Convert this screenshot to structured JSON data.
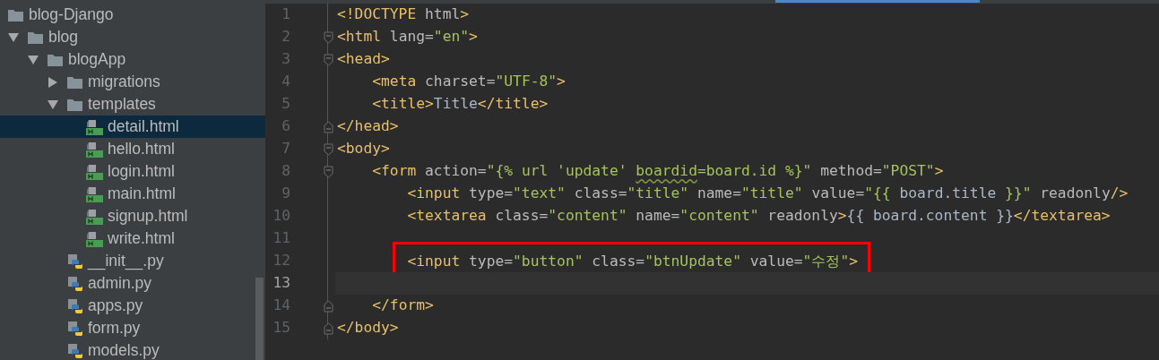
{
  "project_tree": [
    {
      "label": "blog-Django",
      "kind": "folder",
      "selected": false
    },
    {
      "label": "blog",
      "kind": "folder",
      "expanded": true,
      "selected": false,
      "children": [
        {
          "label": "blogApp",
          "kind": "folder",
          "expanded": true,
          "selected": false,
          "children": [
            {
              "label": "migrations",
              "kind": "folder",
              "expanded": false,
              "selected": false
            },
            {
              "label": "templates",
              "kind": "folder",
              "expanded": true,
              "selected": false,
              "children": [
                {
                  "label": "detail.html",
                  "kind": "html",
                  "selected": true
                },
                {
                  "label": "hello.html",
                  "kind": "html",
                  "selected": false
                },
                {
                  "label": "login.html",
                  "kind": "html",
                  "selected": false
                },
                {
                  "label": "main.html",
                  "kind": "html",
                  "selected": false
                },
                {
                  "label": "signup.html",
                  "kind": "html",
                  "selected": false
                },
                {
                  "label": "write.html",
                  "kind": "html",
                  "selected": false
                }
              ]
            },
            {
              "label": "__init__.py",
              "kind": "python",
              "selected": false
            },
            {
              "label": "admin.py",
              "kind": "python",
              "selected": false
            },
            {
              "label": "apps.py",
              "kind": "python",
              "selected": false
            },
            {
              "label": "form.py",
              "kind": "python",
              "selected": false
            },
            {
              "label": "models.py",
              "kind": "python",
              "selected": false
            }
          ]
        }
      ]
    }
  ],
  "editor": {
    "lines": [
      {
        "number": "1",
        "kind": "plain",
        "tokens": [
          {
            "kind": "tag",
            "text": "<!DOCTYPE "
          },
          {
            "kind": "attr",
            "text": "html"
          },
          {
            "kind": "tag",
            "text": ">"
          }
        ]
      },
      {
        "number": "2",
        "kind": "foldstart",
        "tokens": [
          {
            "kind": "tag",
            "text": "<html "
          },
          {
            "kind": "attr",
            "text": "lang="
          },
          {
            "kind": "str",
            "text": "\"en\""
          },
          {
            "kind": "tag",
            "text": ">"
          }
        ]
      },
      {
        "number": "3",
        "kind": "foldstart",
        "tokens": [
          {
            "kind": "tag",
            "text": "<head>"
          }
        ]
      },
      {
        "number": "4",
        "kind": "plain",
        "tokens": [
          {
            "kind": "tag",
            "text": "    <meta "
          },
          {
            "kind": "attr",
            "text": "charset="
          },
          {
            "kind": "str",
            "text": "\"UTF-8\""
          },
          {
            "kind": "tag",
            "text": ">"
          }
        ]
      },
      {
        "number": "5",
        "kind": "plain",
        "tokens": [
          {
            "kind": "tag",
            "text": "    <title>"
          },
          {
            "kind": "text",
            "text": "Title"
          },
          {
            "kind": "tag",
            "text": "</title>"
          }
        ]
      },
      {
        "number": "6",
        "kind": "foldend",
        "tokens": [
          {
            "kind": "tag",
            "text": "</head>"
          }
        ]
      },
      {
        "number": "7",
        "kind": "foldstart",
        "tokens": [
          {
            "kind": "tag",
            "text": "<body>"
          }
        ]
      },
      {
        "number": "8",
        "kind": "foldstart",
        "tokens": [
          {
            "kind": "tag",
            "text": "    <form "
          },
          {
            "kind": "attr",
            "text": "action="
          },
          {
            "kind": "str",
            "text": "\"{% url 'update' "
          },
          {
            "kind": "squiggle",
            "text": "boardid"
          },
          {
            "kind": "str",
            "text": "=board.id %}\" "
          },
          {
            "kind": "attr",
            "text": "method="
          },
          {
            "kind": "str",
            "text": "\"POST\""
          },
          {
            "kind": "tag",
            "text": ">"
          }
        ]
      },
      {
        "number": "9",
        "kind": "plain",
        "tokens": [
          {
            "kind": "tag",
            "text": "        <input "
          },
          {
            "kind": "attr",
            "text": "type="
          },
          {
            "kind": "str",
            "text": "\"text\" "
          },
          {
            "kind": "attr",
            "text": "class="
          },
          {
            "kind": "str",
            "text": "\"title\" "
          },
          {
            "kind": "attr",
            "text": "name="
          },
          {
            "kind": "str",
            "text": "\"title\" "
          },
          {
            "kind": "attr",
            "text": "value="
          },
          {
            "kind": "str",
            "text": "\"{{ "
          },
          {
            "kind": "text",
            "text": "board.title"
          },
          {
            "kind": "str",
            "text": " }}\" "
          },
          {
            "kind": "attr",
            "text": "readonly"
          },
          {
            "kind": "tag",
            "text": "/>"
          }
        ]
      },
      {
        "number": "10",
        "kind": "plain",
        "tokens": [
          {
            "kind": "tag",
            "text": "        <textarea "
          },
          {
            "kind": "attr",
            "text": "class="
          },
          {
            "kind": "str",
            "text": "\"content\" "
          },
          {
            "kind": "attr",
            "text": "name="
          },
          {
            "kind": "str",
            "text": "\"content\" "
          },
          {
            "kind": "attr",
            "text": "readonly"
          },
          {
            "kind": "tag",
            "text": ">"
          },
          {
            "kind": "text",
            "text": "{{ board.content }}"
          },
          {
            "kind": "tag",
            "text": "</textarea>"
          }
        ]
      },
      {
        "number": "11",
        "kind": "plain"
      },
      {
        "number": "12",
        "kind": "plain",
        "highlighted": true,
        "tokens": [
          {
            "kind": "tag",
            "text": "        <input "
          },
          {
            "kind": "attr",
            "text": "type="
          },
          {
            "kind": "str",
            "text": "\"button\" "
          },
          {
            "kind": "attr",
            "text": "class="
          },
          {
            "kind": "str",
            "text": "\"btnUpdate\" "
          },
          {
            "kind": "attr",
            "text": "value="
          },
          {
            "kind": "str",
            "text": "\"수정\""
          },
          {
            "kind": "tag",
            "text": ">"
          }
        ]
      },
      {
        "number": "13",
        "kind": "plain",
        "current": true
      },
      {
        "number": "14",
        "kind": "foldend",
        "tokens": [
          {
            "kind": "tag",
            "text": "    </form>"
          }
        ]
      },
      {
        "number": "15",
        "kind": "foldend",
        "tokens": [
          {
            "kind": "tag",
            "text": "</body>"
          }
        ]
      }
    ]
  }
}
